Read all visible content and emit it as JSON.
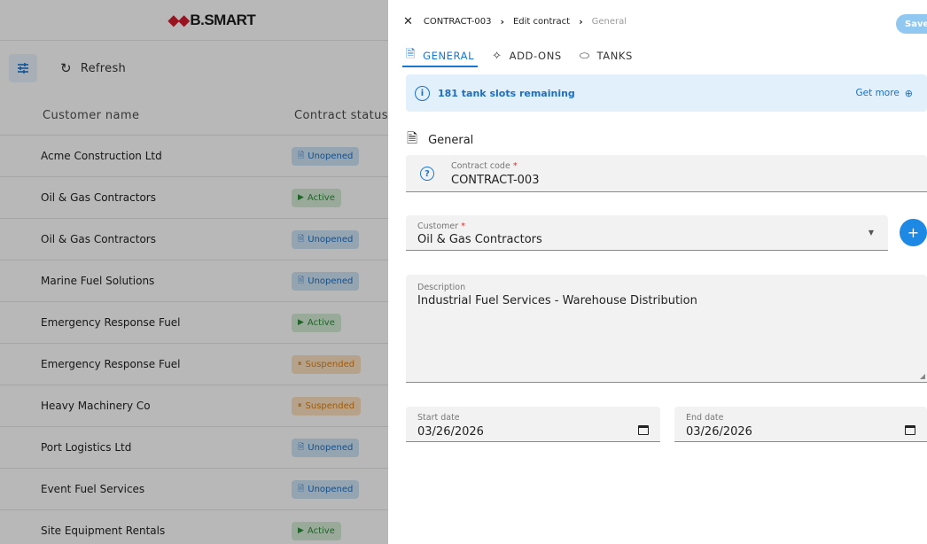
{
  "app": {
    "logo_mark": "◆◆",
    "logo_text": "B.SMART"
  },
  "toolbar": {
    "filter_icon": "tune-icon",
    "refresh_icon": "↻",
    "refresh_label": "Refresh"
  },
  "table": {
    "columns": [
      "Customer name",
      "Contract status"
    ],
    "rows": [
      {
        "customer": "Acme Construction Ltd",
        "status": "Unopened",
        "status_type": "unopened"
      },
      {
        "customer": "Oil & Gas Contractors",
        "status": "Active",
        "status_type": "active"
      },
      {
        "customer": "Oil & Gas Contractors",
        "status": "Unopened",
        "status_type": "unopened"
      },
      {
        "customer": "Marine Fuel Solutions",
        "status": "Unopened",
        "status_type": "unopened"
      },
      {
        "customer": "Emergency Response Fuel",
        "status": "Active",
        "status_type": "active"
      },
      {
        "customer": "Emergency Response Fuel",
        "status": "Suspended",
        "status_type": "suspended"
      },
      {
        "customer": "Heavy Machinery Co",
        "status": "Suspended",
        "status_type": "suspended"
      },
      {
        "customer": "Port Logistics Ltd",
        "status": "Unopened",
        "status_type": "unopened"
      },
      {
        "customer": "Event Fuel Services",
        "status": "Unopened",
        "status_type": "unopened"
      },
      {
        "customer": "Site Equipment Rentals",
        "status": "Active",
        "status_type": "active"
      }
    ]
  },
  "status_icons": {
    "unopened": "🗎",
    "active": "▶",
    "suspended": "⏸"
  },
  "drawer": {
    "close_icon": "✕",
    "breadcrumb": [
      "CONTRACT-003",
      "Edit contract",
      "General"
    ],
    "breadcrumb_sep": "›",
    "save_label": "Save",
    "tabs": [
      {
        "label": "GENERAL",
        "icon": "🗎"
      },
      {
        "label": "ADD-ONS",
        "icon": "✧"
      },
      {
        "label": "TANKS",
        "icon": "⬭"
      }
    ],
    "info": {
      "icon": "i",
      "text": "181 tank slots remaining",
      "link": "Get more",
      "link_icon": "⊕"
    },
    "section": {
      "icon": "🗎",
      "title": "General"
    },
    "contract_code": {
      "label": "Contract code",
      "required": "*",
      "value": "CONTRACT-003",
      "icon": "?"
    },
    "customer": {
      "label": "Customer",
      "required": "*",
      "value": "Oil & Gas Contractors",
      "dropdown_icon": "▼",
      "add_icon": "+"
    },
    "description": {
      "label": "Description",
      "value": "Industrial Fuel Services - Warehouse Distribution",
      "resize_icon": "◢"
    },
    "start_date": {
      "label": "Start date",
      "value": "03/26/2026"
    },
    "end_date": {
      "label": "End date",
      "value": "03/26/2026"
    }
  },
  "colors": {
    "accent": "#1976d2",
    "unopened": "#1e6fbf",
    "active": "#2e8b3a",
    "suspended": "#df7f0b"
  }
}
